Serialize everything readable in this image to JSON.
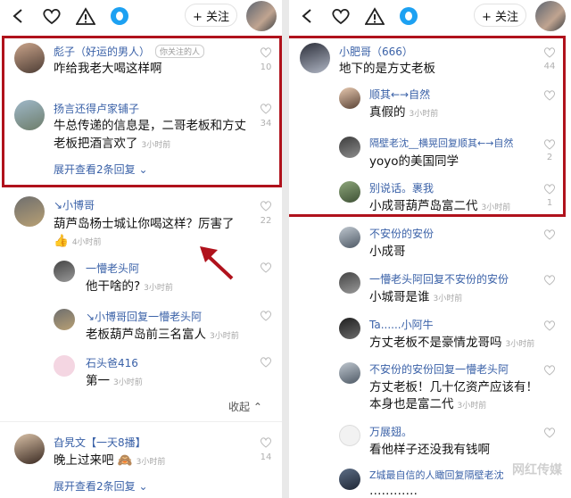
{
  "topbar": {
    "follow_label": "+ 关注"
  },
  "left": {
    "comments": [
      {
        "name": "彪子（好运的男人）",
        "tag": "你关注的人",
        "text": "咋给我老大喝这样啊",
        "time": "",
        "likes": "10"
      },
      {
        "name": "扬言还得卢家铺子",
        "text1": "牛总传递的信息是，二哥老板和方丈",
        "text2": "老板把酒言欢了",
        "time": "3小时前",
        "likes": "34"
      },
      {
        "name": "↘小博哥",
        "text": "葫芦岛杨士城让你喝这样？厉害了",
        "emoji": "👍",
        "time": "4小时前",
        "likes": "22"
      },
      {
        "name": "一懵老头阿",
        "text": "他干啥的?",
        "time": "3小时前"
      },
      {
        "name": "↘小博哥回复一懵老头阿",
        "text": "老板葫芦岛前三名富人",
        "time": "3小时前"
      },
      {
        "name": "石头爸416",
        "text": "第一",
        "time": "3小时前"
      },
      {
        "name": "旮旯文【一天8播】",
        "text": "晚上过来吧",
        "emoji": "🙈",
        "time": "3小时前",
        "likes": "14"
      }
    ],
    "expand1": "展开查看2条回复 ⌄",
    "collapse": "收起 ⌃",
    "expand2": "展开查看2条回复 ⌄"
  },
  "right": {
    "comments": [
      {
        "name": "小肥哥（666）",
        "text": "地下的是方丈老板",
        "likes": "44"
      },
      {
        "name": "顺其←→自然",
        "text": "真假的",
        "time": "3小时前"
      },
      {
        "name": "隔壁老沈__横晃回复顺其←→自然",
        "text": "yoyo的美国同学",
        "likes": "2"
      },
      {
        "name": "别说话。裹我",
        "text": "小成哥葫芦岛富二代",
        "time": "3小时前",
        "likes": "1"
      },
      {
        "name": "不安份的安份",
        "text": "小成哥"
      },
      {
        "name": "一懵老头阿回复不安份的安份",
        "text": "小城哥是谁",
        "time": "3小时前"
      },
      {
        "name": "Ta......小阿牛",
        "text": "方丈老板不是豪情龙哥吗",
        "time": "3小时前"
      },
      {
        "name": "不安份的安份回复一懵老头阿",
        "text1": "方丈老板！几十亿资产应该有！",
        "text2": "本身也是富二代",
        "time": "3小时前"
      },
      {
        "name": "万展翅。",
        "text": "看他样子还没我有钱啊"
      },
      {
        "name": "Z城最自信的人瞰回复隔壁老沈",
        "text": "…………"
      }
    ],
    "watermark": "网红传媒"
  }
}
